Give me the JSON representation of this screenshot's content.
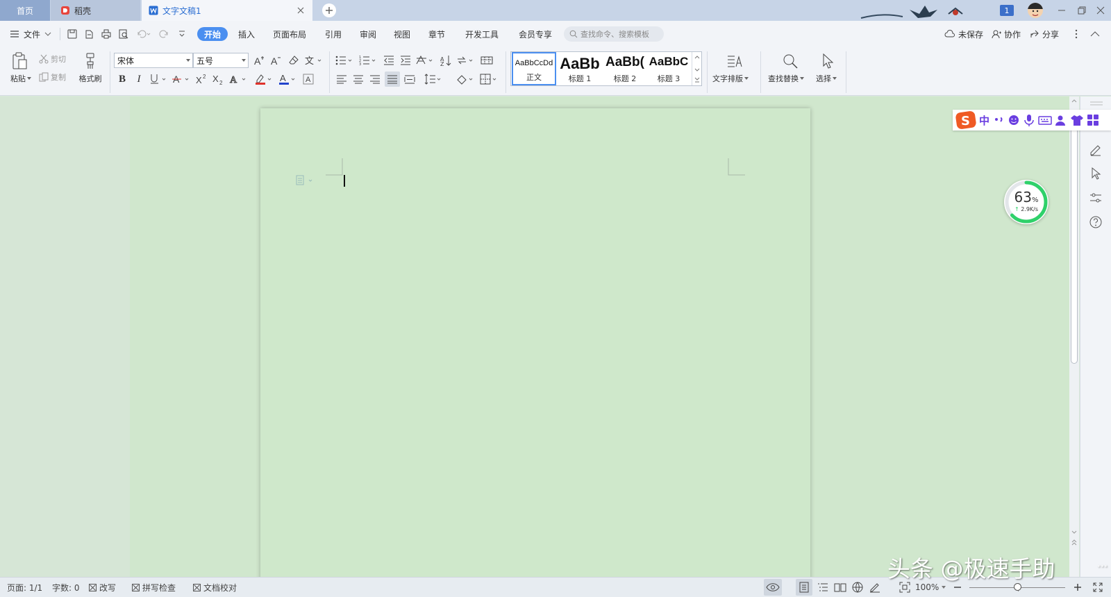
{
  "tabs": {
    "home": "首页",
    "daoke": "稻壳",
    "document": "文字文稿1"
  },
  "window": {
    "badge": "1"
  },
  "menu": {
    "file": "文件",
    "items": [
      "开始",
      "插入",
      "页面布局",
      "引用",
      "审阅",
      "视图",
      "章节",
      "开发工具",
      "会员专享"
    ],
    "search_placeholder": "查找命令、搜索模板",
    "unsaved": "未保存",
    "collaborate": "协作",
    "share": "分享"
  },
  "ribbon": {
    "paste": "粘贴",
    "cut": "剪切",
    "copy": "复制",
    "format_painter": "格式刷",
    "font_name": "宋体",
    "font_size": "五号",
    "styles": [
      {
        "preview": "AaBbCcDd",
        "label": "正文"
      },
      {
        "preview": "AaBb",
        "label": "标题 1"
      },
      {
        "preview": "AaBb(",
        "label": "标题 2"
      },
      {
        "preview": "AaBbC",
        "label": "标题 3"
      }
    ],
    "text_layout": "文字排版",
    "find_replace": "查找替换",
    "select": "选择"
  },
  "ime": {
    "mode": "中"
  },
  "speed_widget": {
    "percent": "63",
    "unit": "%",
    "rate": "2.9K/s"
  },
  "status": {
    "page": "页面: 1/1",
    "words": "字数: 0",
    "overwrite": "改写",
    "spell_check": "拼写检查",
    "doc_check": "文档校对",
    "zoom": "100%"
  },
  "watermark": "头条 @极速手助",
  "colors": {
    "accent": "#4b8ff0",
    "page_green": "#cfe8cb",
    "font_color_red": "#e0322b",
    "font_color_blue": "#2244cc",
    "ime_orange": "#ef5a24",
    "ime_purple": "#6a3ee0",
    "speed_ring": "#2fd16a"
  }
}
